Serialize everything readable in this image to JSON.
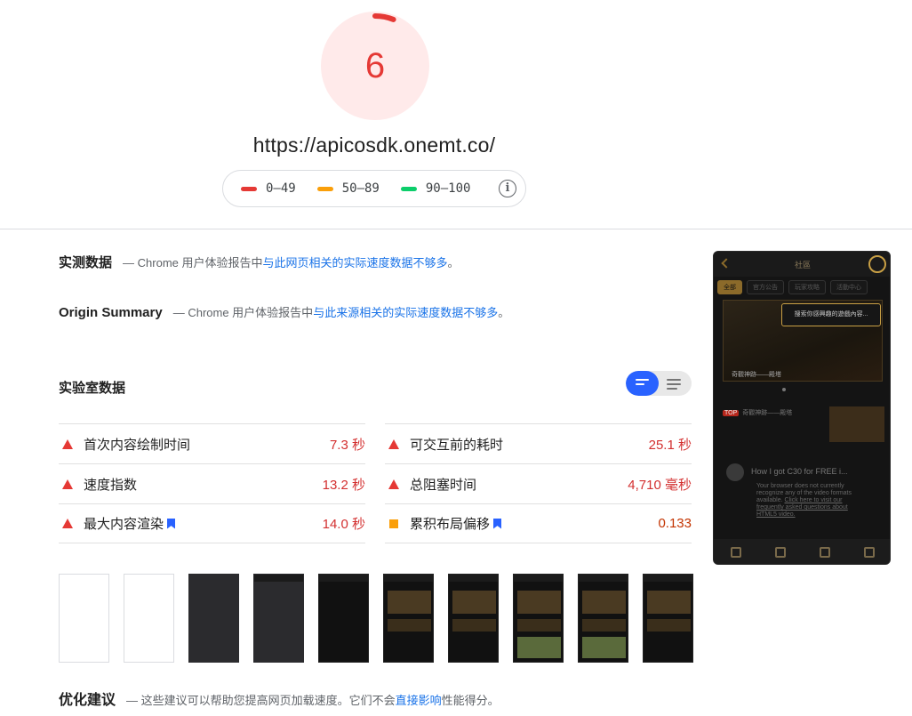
{
  "score": {
    "value": "6",
    "fraction": 0.06,
    "color": "#e53935"
  },
  "url": "https://apicosdk.onemt.co/",
  "legend": [
    {
      "range": "0–49",
      "color": "#e53935"
    },
    {
      "range": "50–89",
      "color": "#fa9f0a"
    },
    {
      "range": "90–100",
      "color": "#0cce6b"
    }
  ],
  "field_data": {
    "title": "实测数据",
    "dash": "—",
    "desc_prefix": "Chrome 用户体验报告中",
    "desc_link": "与此网页相关的实际速度数据不够多",
    "desc_suffix": "。"
  },
  "origin_summary": {
    "title": "Origin Summary",
    "dash": "—",
    "desc_prefix": "Chrome 用户体验报告中",
    "desc_link": "与此来源相关的实际速度数据不够多",
    "desc_suffix": "。"
  },
  "lab_data": {
    "title": "实验室数据",
    "metrics": [
      {
        "label": "首次内容绘制时间",
        "value": "7.3 秒",
        "status": "fail"
      },
      {
        "label": "可交互前的耗时",
        "value": "25.1 秒",
        "status": "fail"
      },
      {
        "label": "速度指数",
        "value": "13.2 秒",
        "status": "fail"
      },
      {
        "label": "总阻塞时间",
        "value": "4,710 毫秒",
        "status": "fail"
      },
      {
        "label": "最大内容渲染",
        "value": "14.0 秒",
        "status": "fail",
        "flag": true
      },
      {
        "label": "累积布局偏移",
        "value": "0.133",
        "status": "average",
        "flag": true
      }
    ]
  },
  "opportunities": {
    "title": "优化建议",
    "dash": "—",
    "desc_prefix": "这些建议可以帮助您提高网页加载速度。它们不会",
    "desc_link": "直接影响",
    "desc_suffix": "性能得分。"
  },
  "phone": {
    "title": "社區",
    "tabs": [
      "全部",
      "官方公告",
      "玩家攻略",
      "活動中心"
    ],
    "tooltip": "搜索你感興趣的遊戲內容...",
    "banner_caption": "奇觀神跡——殿塔",
    "news_tag": "TOP",
    "news_text": "奇觀神跡——殿塔",
    "video_title": "How I got C30 for FREE i...",
    "video_text_1": "Your browser does not currently recognize any of the video formats available.",
    "video_link": "Click here to visit our frequently asked questions about HTML5 video."
  },
  "icons": {
    "info": "info-icon",
    "toggle": "list-toggle-icon",
    "flag": "bookmark-flag-icon"
  }
}
